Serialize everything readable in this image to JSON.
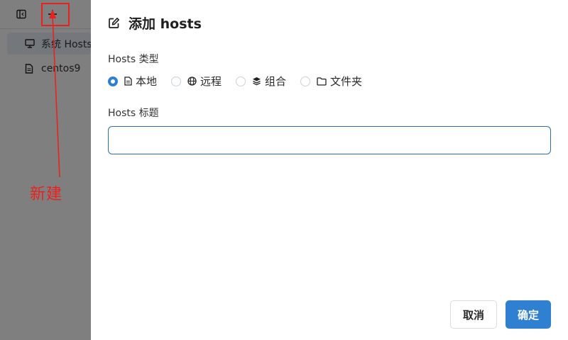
{
  "toolbar": {
    "collapse_icon": "sidebar-toggle-icon",
    "add_icon": "plus-icon"
  },
  "sidebar": {
    "items": [
      {
        "label": "系统 Hosts",
        "icon": "monitor-icon",
        "active": true
      },
      {
        "label": "centos9",
        "icon": "file-icon",
        "active": false
      }
    ]
  },
  "annotation": {
    "text": "新建",
    "color": "#e8231f"
  },
  "dialog": {
    "title": "添加 hosts",
    "type_label": "Hosts 类型",
    "types": [
      {
        "label": "本地",
        "icon": "file-icon",
        "checked": true
      },
      {
        "label": "远程",
        "icon": "globe-icon",
        "checked": false
      },
      {
        "label": "组合",
        "icon": "layers-icon",
        "checked": false
      },
      {
        "label": "文件夹",
        "icon": "folder-icon",
        "checked": false
      }
    ],
    "name_label": "Hosts 标题",
    "name_value": "",
    "cancel_label": "取消",
    "confirm_label": "确定"
  },
  "colors": {
    "accent": "#2f80d0",
    "annotation": "#e8231f"
  }
}
